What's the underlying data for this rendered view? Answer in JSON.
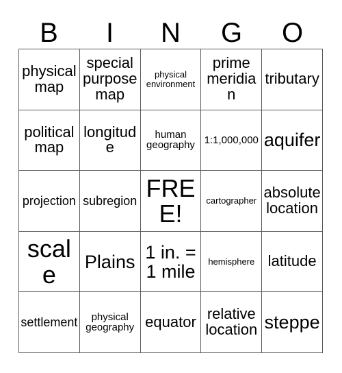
{
  "card": {
    "title": "BINGO",
    "header_letters": [
      "B",
      "I",
      "N",
      "G",
      "O"
    ],
    "free_space_label": "FREE!",
    "grid": [
      [
        {
          "text": "physical map",
          "size": "md"
        },
        {
          "text": "special purpose map",
          "size": "md"
        },
        {
          "text": "physical environment",
          "size": "xxs"
        },
        {
          "text": "prime meridian",
          "size": "md"
        },
        {
          "text": "tributary",
          "size": "md"
        }
      ],
      [
        {
          "text": "political map",
          "size": "md"
        },
        {
          "text": "longitude",
          "size": "md"
        },
        {
          "text": "human geography",
          "size": "xs"
        },
        {
          "text": "1:1,000,000",
          "size": "xs"
        },
        {
          "text": "aquifer",
          "size": "lg"
        }
      ],
      [
        {
          "text": "projection",
          "size": "sm"
        },
        {
          "text": "subregion",
          "size": "sm"
        },
        {
          "text": "FREE!",
          "size": "xl"
        },
        {
          "text": "cartographer",
          "size": "xxs"
        },
        {
          "text": "absolute location",
          "size": "md"
        }
      ],
      [
        {
          "text": "scale",
          "size": "xl"
        },
        {
          "text": "Plains",
          "size": "lg"
        },
        {
          "text": "1 in. = 1 mile",
          "size": "lg"
        },
        {
          "text": "hemisphere",
          "size": "xxs"
        },
        {
          "text": "latitude",
          "size": "md"
        }
      ],
      [
        {
          "text": "settlement",
          "size": "sm"
        },
        {
          "text": "physical geography",
          "size": "xs"
        },
        {
          "text": "equator",
          "size": "md"
        },
        {
          "text": "relative location",
          "size": "md"
        },
        {
          "text": "steppe",
          "size": "lg"
        }
      ]
    ]
  },
  "colors": {
    "border": "#595959",
    "text": "#000000",
    "background": "#ffffff"
  }
}
